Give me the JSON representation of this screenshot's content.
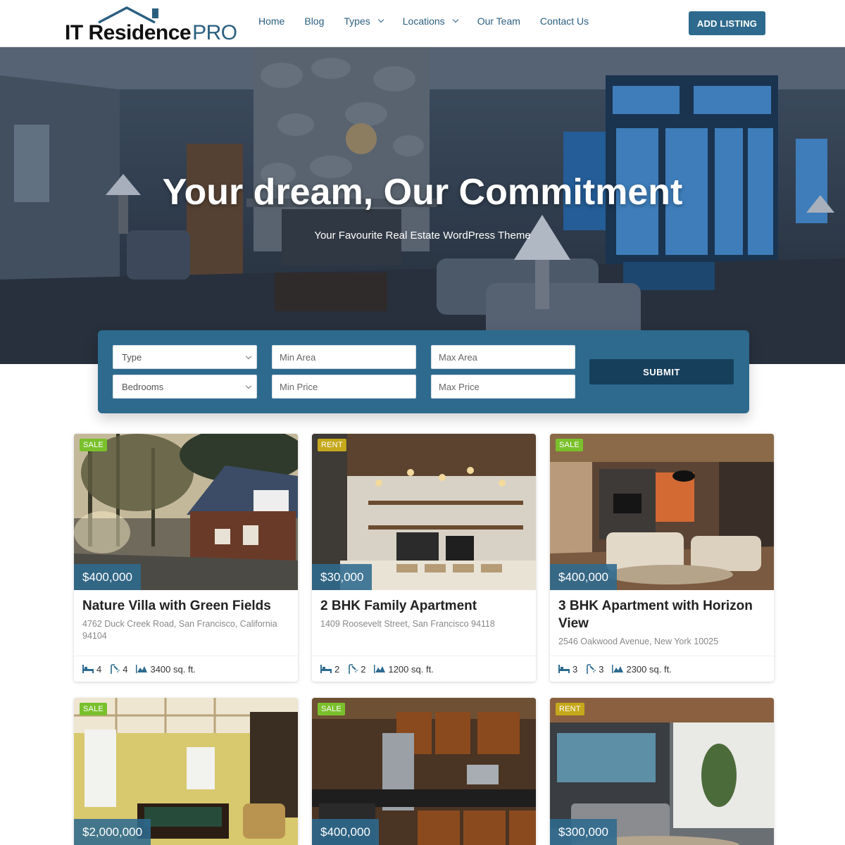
{
  "brand": {
    "name": "IT Residence",
    "suffix": "PRO"
  },
  "nav": {
    "items": [
      {
        "label": "Home"
      },
      {
        "label": "Blog"
      },
      {
        "label": "Types",
        "dropdown": true
      },
      {
        "label": "Locations",
        "dropdown": true
      },
      {
        "label": "Our Team"
      },
      {
        "label": "Contact Us"
      }
    ],
    "cta_label": "ADD LISTING"
  },
  "hero": {
    "title": "Your dream, Our Commitment",
    "subtitle": "Your Favourite Real Estate WordPress Theme"
  },
  "search": {
    "type_placeholder": "Type",
    "bedrooms_placeholder": "Bedrooms",
    "min_area_placeholder": "Min Area",
    "max_area_placeholder": "Max Area",
    "min_price_placeholder": "Min Price",
    "max_price_placeholder": "Max Price",
    "submit_label": "SUBMIT"
  },
  "colors": {
    "primary": "#2d6a8e",
    "dark": "#163f5c",
    "sale_badge": "#7ac02c",
    "rent_badge": "#c5a81b"
  },
  "listings": [
    {
      "badge": "SALE",
      "price": "$400,000",
      "title": "Nature Villa with Green Fields",
      "address": "4762 Duck Creek Road, San Francisco, California 94104",
      "beds": "4",
      "baths": "4",
      "area": "3400 sq. ft.",
      "image": "house-exterior"
    },
    {
      "badge": "RENT",
      "price": "$30,000",
      "title": "2 BHK Family Apartment",
      "address": "1409 Roosevelt Street, San Francisco 94118",
      "beds": "2",
      "baths": "2",
      "area": "1200 sq. ft.",
      "image": "cafe-kitchen"
    },
    {
      "badge": "SALE",
      "price": "$400,000",
      "title": "3 BHK Apartment with Horizon View",
      "address": "2546 Oakwood Avenue, New York 10025",
      "beds": "3",
      "baths": "3",
      "area": "2300 sq. ft.",
      "image": "living-room"
    },
    {
      "badge": "SALE",
      "price": "$2,000,000",
      "image": "billiard-room"
    },
    {
      "badge": "SALE",
      "price": "$400,000",
      "image": "kitchen"
    },
    {
      "badge": "RENT",
      "price": "$300,000",
      "image": "bedroom"
    }
  ]
}
